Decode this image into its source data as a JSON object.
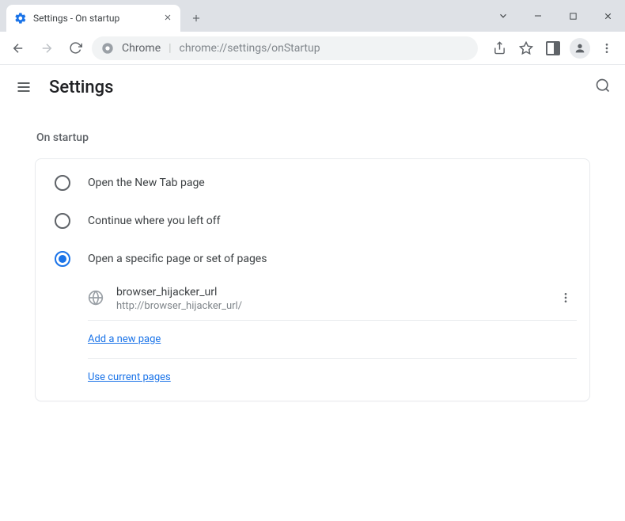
{
  "tab": {
    "title": "Settings - On startup"
  },
  "omnibox": {
    "scheme_label": "Chrome",
    "url": "chrome://settings/onStartup"
  },
  "header": {
    "title": "Settings"
  },
  "section": {
    "title": "On startup"
  },
  "options": [
    {
      "label": "Open the New Tab page",
      "selected": false
    },
    {
      "label": "Continue where you left off",
      "selected": false
    },
    {
      "label": "Open a specific page or set of pages",
      "selected": true
    }
  ],
  "pages": [
    {
      "name": "browser_hijacker_url",
      "url": "http://browser_hijacker_url/"
    }
  ],
  "links": {
    "add_page": "Add a new page",
    "use_current": "Use current pages"
  }
}
